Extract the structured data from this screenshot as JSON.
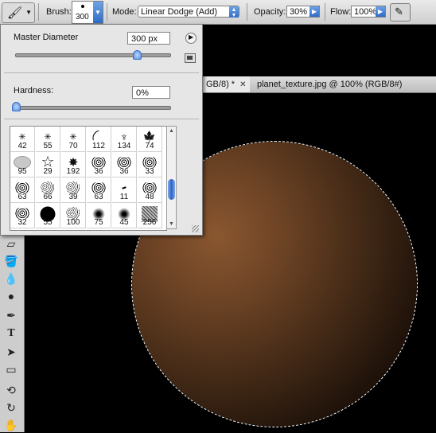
{
  "options_bar": {
    "brush_label": "Brush:",
    "brush_size": "300",
    "mode_label": "Mode:",
    "mode_value": "Linear Dodge (Add)",
    "opacity_label": "Opacity:",
    "opacity_value": "30%",
    "flow_label": "Flow:",
    "flow_value": "100%"
  },
  "document_tabs": [
    {
      "label": "GB/8) *",
      "active": true
    },
    {
      "label": "planet_texture.jpg @ 100% (RGB/8#)",
      "active": false
    }
  ],
  "brush_picker": {
    "master_diameter_label": "Master Diameter",
    "master_diameter_value": "300 px",
    "master_diameter_fraction": 0.79,
    "hardness_label": "Hardness:",
    "hardness_value": "0%",
    "hardness_fraction": 0.0,
    "brush_sizes": [
      "42",
      "55",
      "70",
      "112",
      "134",
      "74",
      "95",
      "29",
      "192",
      "36",
      "36",
      "33",
      "63",
      "66",
      "39",
      "63",
      "11",
      "48",
      "32",
      "55",
      "100",
      "75",
      "45",
      "256"
    ]
  },
  "colors": {
    "accent_blue": "#2f6cc8",
    "sphere_highlight": "#8a5730",
    "canvas_bg": "#000000"
  }
}
